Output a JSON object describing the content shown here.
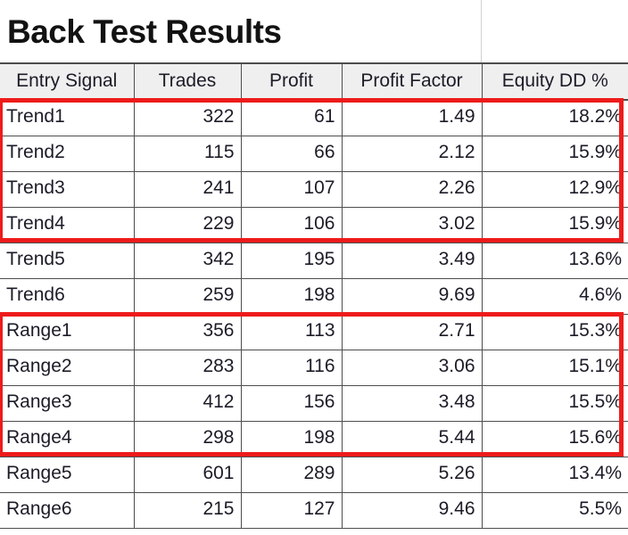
{
  "title": "Back Test Results",
  "table": {
    "columns": [
      "Entry Signal",
      "Trades",
      "Profit",
      "Profit Factor",
      "Equity DD %"
    ],
    "rows": [
      {
        "signal": "Trend1",
        "trades": "322",
        "profit": "61",
        "profit_factor": "1.49",
        "equity_dd": "18.2%"
      },
      {
        "signal": "Trend2",
        "trades": "115",
        "profit": "66",
        "profit_factor": "2.12",
        "equity_dd": "15.9%"
      },
      {
        "signal": "Trend3",
        "trades": "241",
        "profit": "107",
        "profit_factor": "2.26",
        "equity_dd": "12.9%"
      },
      {
        "signal": "Trend4",
        "trades": "229",
        "profit": "106",
        "profit_factor": "3.02",
        "equity_dd": "15.9%"
      },
      {
        "signal": "Trend5",
        "trades": "342",
        "profit": "195",
        "profit_factor": "3.49",
        "equity_dd": "13.6%"
      },
      {
        "signal": "Trend6",
        "trades": "259",
        "profit": "198",
        "profit_factor": "9.69",
        "equity_dd": "4.6%"
      },
      {
        "signal": "Range1",
        "trades": "356",
        "profit": "113",
        "profit_factor": "2.71",
        "equity_dd": "15.3%"
      },
      {
        "signal": "Range2",
        "trades": "283",
        "profit": "116",
        "profit_factor": "3.06",
        "equity_dd": "15.1%"
      },
      {
        "signal": "Range3",
        "trades": "412",
        "profit": "156",
        "profit_factor": "3.48",
        "equity_dd": "15.5%"
      },
      {
        "signal": "Range4",
        "trades": "298",
        "profit": "198",
        "profit_factor": "5.44",
        "equity_dd": "15.6%"
      },
      {
        "signal": "Range5",
        "trades": "601",
        "profit": "289",
        "profit_factor": "5.26",
        "equity_dd": "13.4%"
      },
      {
        "signal": "Range6",
        "trades": "215",
        "profit": "127",
        "profit_factor": "9.46",
        "equity_dd": "5.5%"
      }
    ]
  },
  "highlights": [
    {
      "name": "trend-group-highlight",
      "first_row": "Trend1",
      "last_row": "Trend4",
      "color": "#ee1b1b"
    },
    {
      "name": "range-group-highlight",
      "first_row": "Range1",
      "last_row": "Range4",
      "color": "#ee1b1b"
    }
  ],
  "colors": {
    "highlight": "#ee1b1b",
    "header_bg": "#efefef",
    "grid_line": "#4d4d4d",
    "text": "#1c1c28",
    "background": "#ffffff"
  }
}
